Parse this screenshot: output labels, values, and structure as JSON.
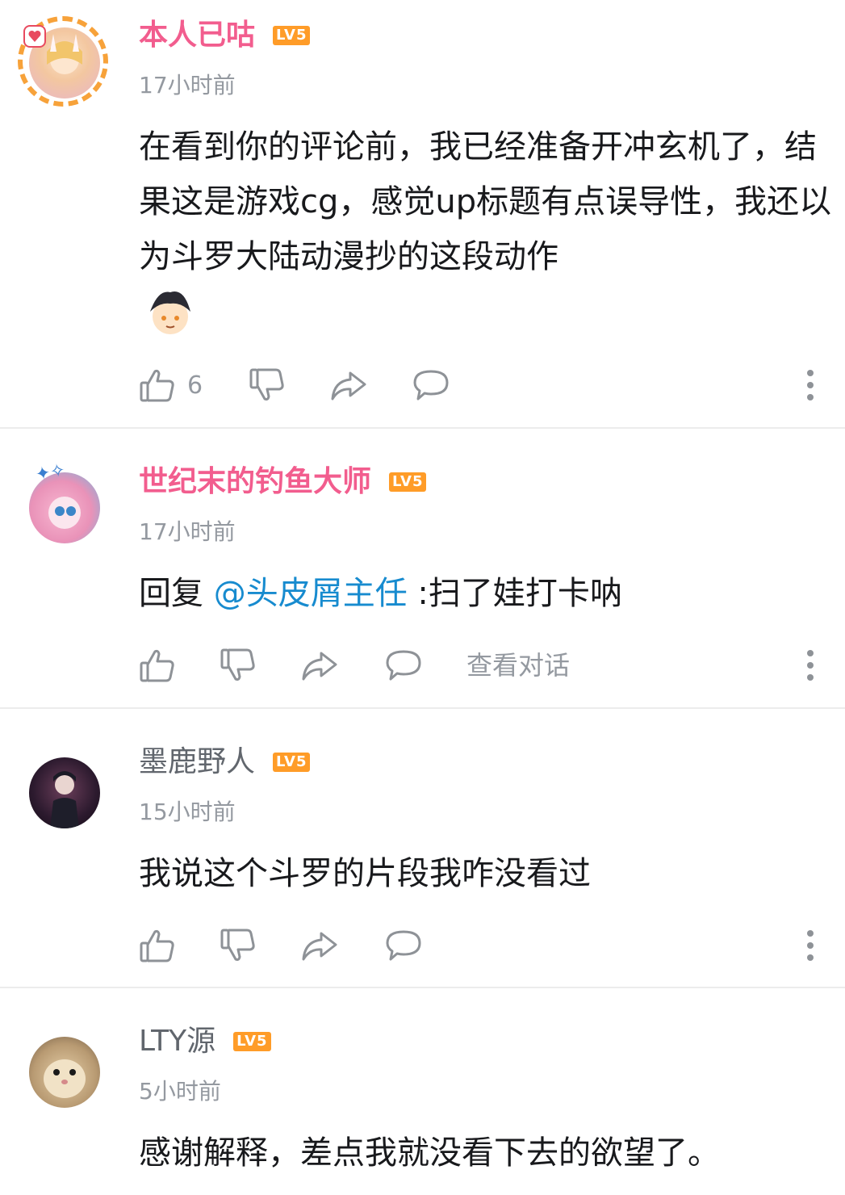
{
  "comments": [
    {
      "username": "本人已咕",
      "name_style": "vip",
      "level": "LV5",
      "time": "17小时前",
      "text": "在看到你的评论前，我已经准备开冲玄机了，结果这是游戏cg，感觉up标题有点误导性，我还以为斗罗大陆动漫抄的这段动作",
      "like_count": "6"
    },
    {
      "username": "世纪末的钓鱼大师",
      "name_style": "vip",
      "level": "LV5",
      "time": "17小时前",
      "reply_prefix": "回复 ",
      "mention": "@头皮屑主任",
      "reply_text": " :扫了娃打卡呐",
      "view_conversation": "查看对话"
    },
    {
      "username": "墨鹿野人",
      "name_style": "normal",
      "level": "LV5",
      "time": "15小时前",
      "text": "我说这个斗罗的片段我咋没看过"
    },
    {
      "username": "LTY源",
      "name_style": "normal",
      "level": "LV5",
      "time": "5小时前",
      "text": "感谢解释，差点我就没看下去的欲望了。"
    }
  ],
  "colors": {
    "vip_name": "#f25d8e",
    "level_badge": "#ff9c28",
    "mention": "#178bcf",
    "meta_gray": "#9499a0"
  },
  "icons": [
    "like-icon",
    "dislike-icon",
    "share-icon",
    "reply-icon",
    "more-icon",
    "emote-sticker"
  ]
}
